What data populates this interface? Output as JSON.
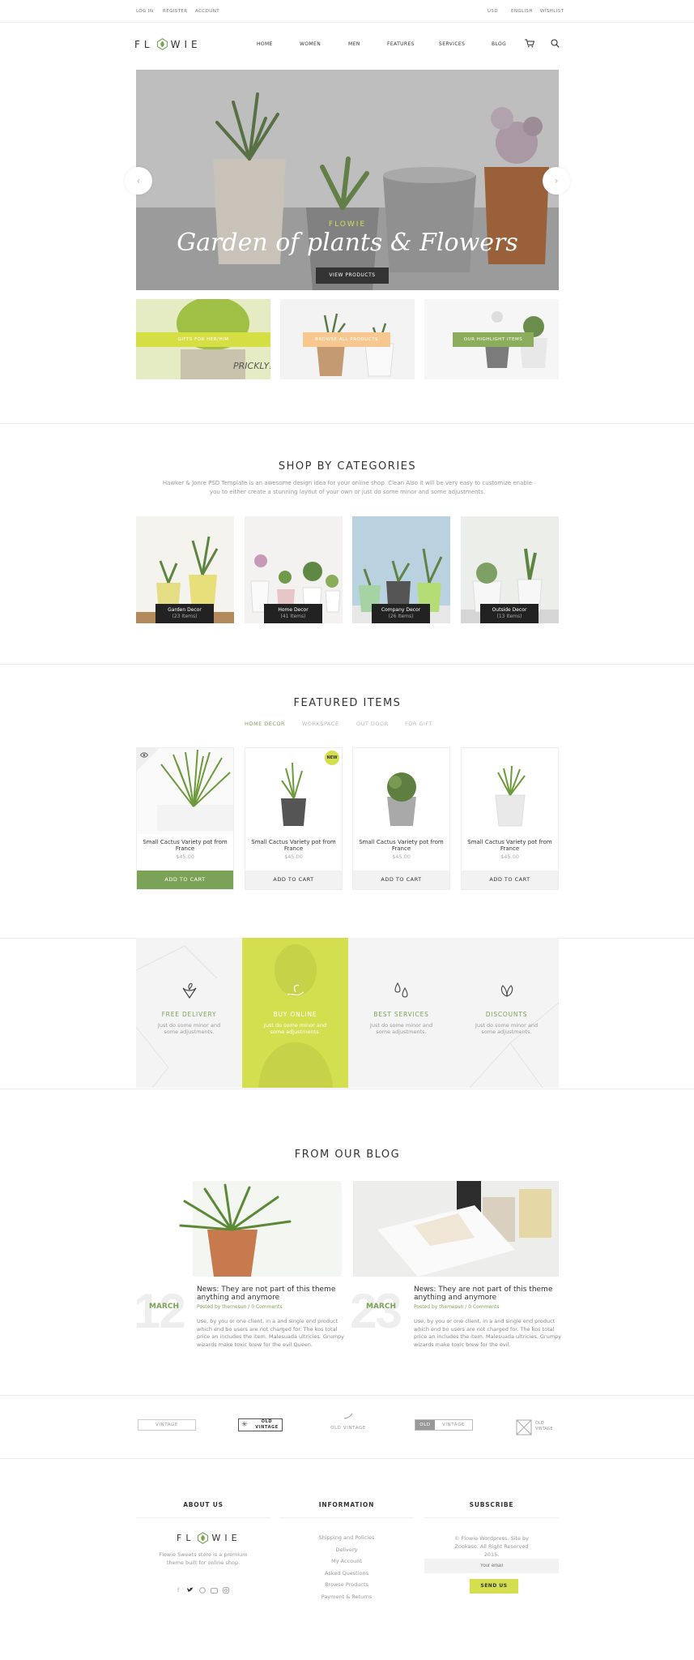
{
  "topbar": {
    "log_in": "LOG IN",
    "register": "REGISTER",
    "account": "ACCOUNT",
    "currency": "USD",
    "language": "ENGLISH",
    "wishlist": "WISHLIST"
  },
  "header": {
    "logo_left": "FL",
    "logo_right": "WIE",
    "nav": [
      "HOME",
      "WOMEN",
      "MEN",
      "FEATURES",
      "SERVICES",
      "BLOG"
    ]
  },
  "hero": {
    "subtitle": "FLOWIE",
    "title": "Garden of plants & Flowers",
    "button": "VIEW PRODUCTS"
  },
  "promos": [
    "GIFTS FOR HER/HIM",
    "BROWSE ALL PRODUCTS",
    "OUR HIGHLIGHT ITEMS"
  ],
  "categories": {
    "title": "SHOP BY CATEGORIES",
    "description": "Hawker & Jonre PSD Template is an awesome design idea for your online shop. Clean Also it will be very easy to customize enable you to either create a stunning layout of your own or just do some minor and some adjustments.",
    "items": [
      {
        "name": "Garden Decor",
        "count": "(23 Items)"
      },
      {
        "name": "Home Decor",
        "count": "(41 Items)"
      },
      {
        "name": "Company Decor",
        "count": "(26 Items)"
      },
      {
        "name": "Outside Decor",
        "count": "(13 Items)"
      }
    ]
  },
  "featured": {
    "title": "FEATURED ITEMS",
    "tabs": [
      "HOME DECOR",
      "WORKSPACE",
      "OUT DOOR",
      "FOR GIFT"
    ],
    "badge": "NEW",
    "products": [
      {
        "name": "Small Cactus Variety pot from France",
        "price": "$45.00",
        "button": "ADD TO CART"
      },
      {
        "name": "Small Cactus Variety pot from France",
        "price": "$45.00",
        "button": "ADD TO CART"
      },
      {
        "name": "Small Cactus Variety pot from France",
        "price": "$45.00",
        "button": "ADD TO CART"
      },
      {
        "name": "Small Cactus Variety pot from France",
        "price": "$45.00",
        "button": "ADD TO CART"
      }
    ]
  },
  "services": [
    {
      "title": "FREE DELIVERY",
      "text": "Just do some minor and some adjustments.",
      "icon": "plant-hand-icon"
    },
    {
      "title": "BUY ONLINE",
      "text": "Just do some minor and some adjustments.",
      "icon": "sprout-hand-icon"
    },
    {
      "title": "BEST SERVICES",
      "text": "Just do some minor and some adjustments.",
      "icon": "water-drops-icon"
    },
    {
      "title": "DISCOUNTS",
      "text": "Just do some minor and some adjustments.",
      "icon": "leaf-icon"
    }
  ],
  "blog": {
    "title": "FROM OUR BLOG",
    "posts": [
      {
        "day": "12",
        "month": "MARCH",
        "title": "News: They are not part of this theme anything and anymore",
        "meta_prefix": "Posted by ",
        "author": "themesun",
        "meta_sep": " / ",
        "comments": "0 Comments",
        "text": "Use, by you or one client, in a and single end product which end bo users are not charged for. The kos total price an includes the item. Malesuada ultricies. Grumpy wizards make toxic brew for the evil Queen."
      },
      {
        "day": "23",
        "month": "MARCH",
        "title": "News: They are not part of this theme anything and anymore",
        "meta_prefix": "Posted by ",
        "author": "themesun",
        "meta_sep": " / ",
        "comments": "0 Comments",
        "text": "Use, by you or one client, in a and single end product which end bo users are not charged for. The kos total price an includes the item. Malesuada ultricies. Grumpy wizards make toxic brew for the evil."
      }
    ]
  },
  "brands": [
    "VINTAGE",
    "OLD",
    "VINTAGE",
    "OLD VINTAGE",
    "OLD",
    "VINTAGE",
    "OLD",
    "VINTAGE"
  ],
  "footer": {
    "about_title": "ABOUT US",
    "about_text": "Flowie Sweets store is a premium theme built for online shop.",
    "info_title": "INFORMATION",
    "links": [
      "Shipping and Policies",
      "Delivery",
      "My Account",
      "Asked Questions",
      "Browse Products",
      "Payment & Returns"
    ],
    "subscribe_title": "SUBSCRIBE",
    "copyright": "© Flowie Wordpress. Site by Zookaso. All Right Reserved 2015.",
    "email_placeholder": "Your email",
    "send": "SEND US"
  },
  "colors": {
    "accent_green": "#7ba357",
    "lime": "#d3df4e",
    "peach": "#f6c88f",
    "dark": "#222222"
  }
}
